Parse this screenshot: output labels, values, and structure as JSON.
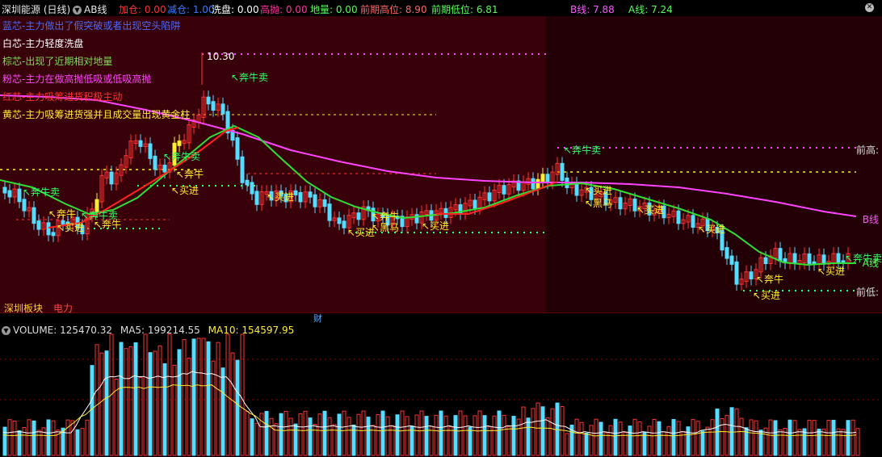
{
  "header": {
    "title": "深圳能源 (日线)",
    "indicator_button": "AB线",
    "stats": [
      {
        "label": "加仓: ",
        "value": "0.00",
        "color": "#ff3333"
      },
      {
        "label": "减仓: ",
        "value": "1.00",
        "color": "#3a7bff"
      },
      {
        "label": "洗盘: ",
        "value": "0.00",
        "color": "#ffffff"
      },
      {
        "label": "高抛: ",
        "value": "0.00",
        "color": "#ff3399"
      },
      {
        "label": "地量: ",
        "value": "0.00",
        "color": "#55ff55"
      },
      {
        "label": "前期高位: ",
        "value": "8.90",
        "color": "#ff6666"
      },
      {
        "label": "前期低位: ",
        "value": "6.81",
        "color": "#55ff55"
      },
      {
        "label": "B线: ",
        "value": "7.88",
        "color": "#ff55ff"
      },
      {
        "label": "A线: ",
        "value": "7.24",
        "color": "#55ff55"
      }
    ]
  },
  "legend": [
    {
      "text": "蓝芯-主力做出了假突破或者出现空头陷阱",
      "color": "#4a6bff"
    },
    {
      "text": "白芯-主力轻度洗盘",
      "color": "#ffffff"
    },
    {
      "text": "棕芯-出现了近期相对地量",
      "color": "#7fdd55"
    },
    {
      "text": "粉芯-主力在做高抛低吸或低吸高抛",
      "color": "#ff44ff"
    },
    {
      "text": "红芯-主力吸筹进货积极主动",
      "color": "#ff3333"
    },
    {
      "text": "黄芯-主力吸筹进货强并且成交量出现黄金柱",
      "color": "#ffee33"
    }
  ],
  "chart": {
    "high_label": "10.30",
    "right_labels": {
      "prev_high": "前高:",
      "b_line": "B线",
      "a_line": "A线",
      "prev_low": "前低:"
    },
    "bottom_tags": [
      {
        "text": "深圳板块",
        "color": "#ffcc33"
      },
      {
        "text": "电力",
        "color": "#ff4444"
      }
    ],
    "separator_label": "财",
    "signals": {
      "buy": "买进",
      "bull": "奔牛",
      "bull_sell": "奔牛卖",
      "dark_horse": "黑马"
    }
  },
  "volume": {
    "label": "VOLUME: ",
    "value": "125470.32",
    "ma5_label": "MA5: ",
    "ma5": "199214.55",
    "ma10_label": "MA10: ",
    "ma10": "154597.95"
  }
}
